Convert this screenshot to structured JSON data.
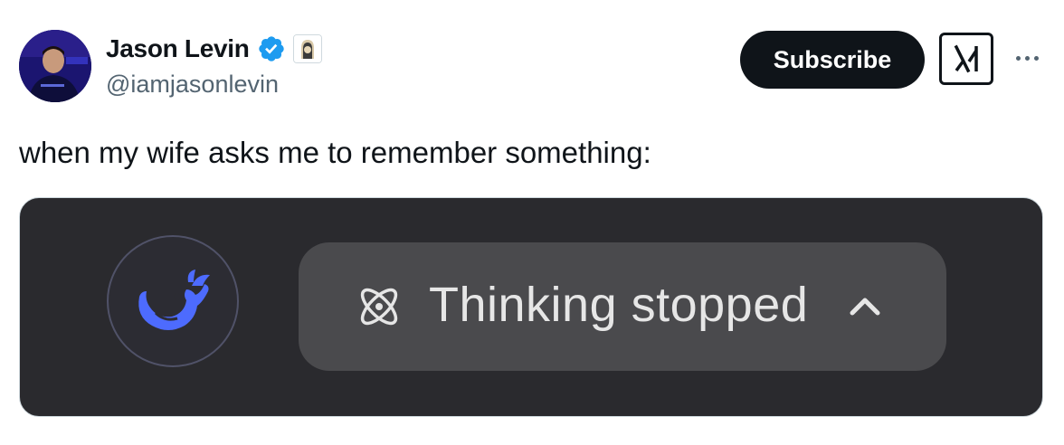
{
  "author": {
    "name": "Jason Levin",
    "handle": "@iamjasonlevin",
    "avatar_icon": "profile-photo",
    "verified_color": "#1d9bf0"
  },
  "header": {
    "subscribe_label": "Subscribe",
    "grok_icon": "grok-icon",
    "more_icon": "more-icon"
  },
  "tweet": {
    "text": "when my wife asks me to remember something:"
  },
  "media": {
    "logo_icon": "deepseek-whale-icon",
    "status_icon": "atom-icon",
    "status_text": "Thinking stopped",
    "chevron_icon": "chevron-up-icon",
    "background_color": "#2a2a2e",
    "pill_color": "#4a4a4d",
    "logo_color": "#4d6bfe"
  }
}
